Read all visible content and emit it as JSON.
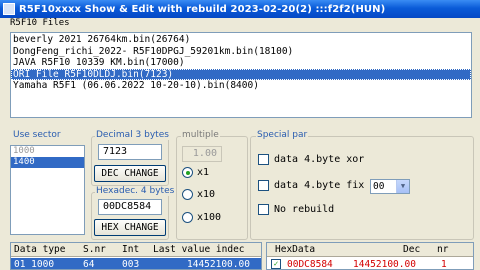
{
  "window": {
    "title": "R5F10xxxx Show & Edit with rebuild 2023-02-20(2) :::f2f2(HUN)"
  },
  "files": {
    "label": "R5F10 Files",
    "items": [
      "beverly 2021 26764km.bin(26764)",
      "DongFeng_richi_2022- R5F10DPGJ_59201km.bin(18100)",
      "JAVA R5F10 10339 KM.bin(17000)",
      "ORI File R5F10DLDJ.bin(7123)",
      "Yamaha R5F1  (06.06.2022 10-20-10).bin(8400)"
    ],
    "selected_index": 3
  },
  "use_sector": {
    "label": "Use sector",
    "items": [
      "1000",
      "1400"
    ],
    "selected_index": 1
  },
  "decimal": {
    "label": "Decimal 3 bytes",
    "value": "7123",
    "button": "DEC CHANGE"
  },
  "hexadec": {
    "label": "Hexadec. 4 bytes",
    "value": "00DC8584",
    "button": "HEX CHANGE"
  },
  "multiple": {
    "label": "multiple",
    "value": "1.00",
    "options": [
      "x1",
      "x10",
      "x100"
    ],
    "selected_index": 0
  },
  "special": {
    "label": "Special par",
    "xor_label": "data 4.byte xor",
    "fix_label": "data 4.byte fix",
    "fix_value": "00",
    "norebuild_label": "No rebuild"
  },
  "grid_left": {
    "headers": [
      "Data type",
      "S.nr",
      "Int",
      "Last value indec"
    ],
    "row": [
      "01 1000",
      "64",
      "003",
      "14452100.00"
    ]
  },
  "grid_right": {
    "headers": [
      "HexData",
      "Dec",
      "nr"
    ],
    "row": [
      "00DC8584",
      "14452100.00",
      "1"
    ]
  },
  "colors": {
    "title_bar": "#0a5bd8",
    "selection": "#316ac5",
    "highlight_text": "#d40000"
  }
}
